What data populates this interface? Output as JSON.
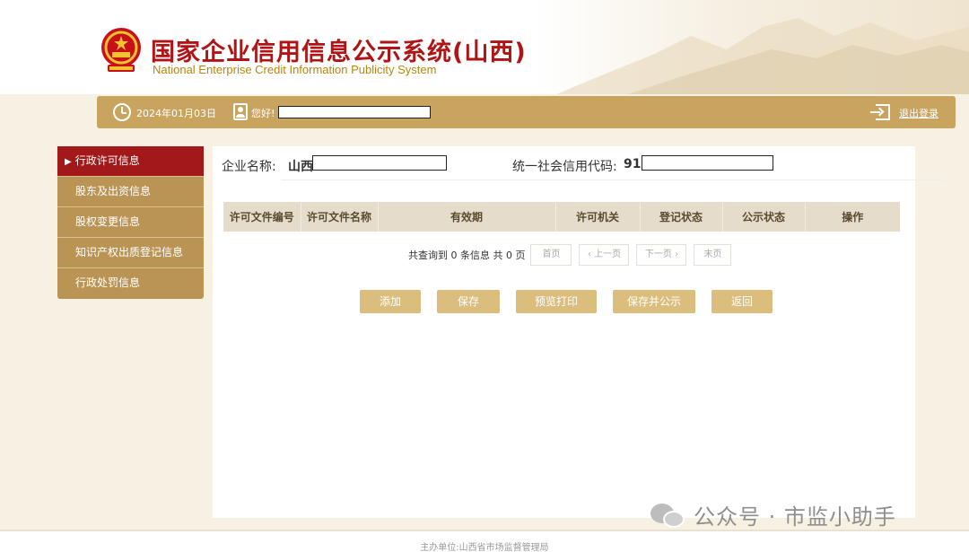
{
  "header": {
    "title": "国家企业信用信息公示系统(山西)",
    "subtitle": "National Enterprise Credit Information Publicity System"
  },
  "topbar": {
    "date": "2024年01月03日",
    "greeting": "您好!",
    "logout": "退出登录"
  },
  "sidebar": {
    "items": [
      {
        "label": "行政许可信息",
        "active": true
      },
      {
        "label": "股东及出资信息",
        "active": false
      },
      {
        "label": "股权变更信息",
        "active": false
      },
      {
        "label": "知识产权出质登记信息",
        "active": false
      },
      {
        "label": "行政处罚信息",
        "active": false
      }
    ]
  },
  "company": {
    "name_label": "企业名称:",
    "name_value": "山西",
    "code_label": "统一社会信用代码:",
    "code_value": "91"
  },
  "table": {
    "columns": [
      "许可文件编号",
      "许可文件名称",
      "有效期",
      "许可机关",
      "登记状态",
      "公示状态",
      "操作"
    ],
    "rows": []
  },
  "pager": {
    "info": "共查询到 0 条信息 共 0 页",
    "first": "首页",
    "prev": "‹ 上一页",
    "next": "下一页 ›",
    "last": "末页"
  },
  "actions": {
    "add": "添加",
    "save": "保存",
    "preview": "预览打印",
    "save_publish": "保存并公示",
    "back": "返回"
  },
  "watermark": {
    "text": "公众号 · 市监小助手"
  },
  "footer": {
    "text": "主办单位:山西省市场监督管理局"
  },
  "colors": {
    "brand_red": "#b01414",
    "gold": "#c9a45f",
    "sidebar_gold": "#b99454",
    "active_red": "#a31818",
    "button_gold": "#dbbe7e"
  }
}
